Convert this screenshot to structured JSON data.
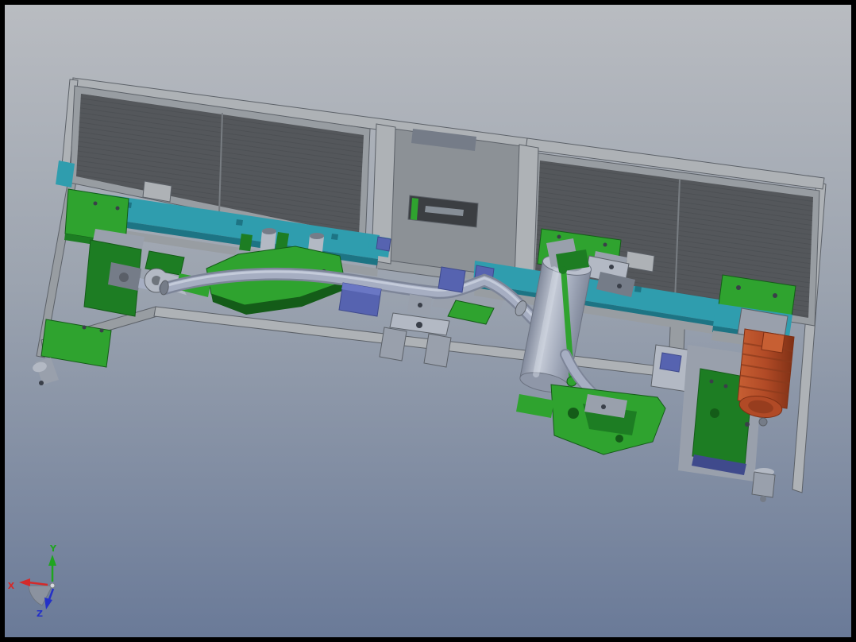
{
  "triad": {
    "x_label": "X",
    "y_label": "Y",
    "z_label": "Z"
  },
  "colors": {
    "bg_top": "#b9bcc1",
    "bg_mid": "#9ba3af",
    "bg_bottom": "#6a7a98",
    "frame_light": "#aeb2b6",
    "frame_mid": "#989da2",
    "edge": "#5c6168",
    "panel_dark": "#54575b",
    "panel_line": "#787d82",
    "gray_mid": "#8c9196",
    "gray_dark_panel": "#3b3e42",
    "teal": "#2f9dae",
    "teal_dark": "#1d7484",
    "green": "#2fa32f",
    "green_dark": "#1d7d23",
    "green_deep": "#145c18",
    "tube": "#a6aec2",
    "tube_light": "#ccd2e0",
    "tube_dark": "#7d8598",
    "cyl_light": "#c4cad6",
    "cyl_mid": "#9fa7b8",
    "cyl_dark": "#828a9c",
    "gray_part": "#99a0ac",
    "gray_part_light": "#b3b9c4",
    "gray_part_dark": "#757c88",
    "blue_part": "#5663b0",
    "blue_light": "#6a77c4",
    "blue_dark": "#3f4a8c",
    "orange": "#b14a26",
    "orange_dark": "#7e3015",
    "orange_light": "#c75f33",
    "bolt": "#3a3f49",
    "x_axis": "#d42a2a",
    "y_axis": "#1fa51f",
    "z_axis": "#2431c8",
    "triad_gray": "#9096a0"
  },
  "model": {
    "parts": [
      "main-frame",
      "left-guard-panel",
      "right-guard-panel",
      "center-bay",
      "control-panel",
      "left-conveyor-belt",
      "right-conveyor-belt",
      "left-end-bracket-set",
      "left-roller",
      "welding-jig-left",
      "bent-tube-workpiece",
      "center-support-fixture",
      "guide-block",
      "roller-cylinder",
      "lower-green-fixture",
      "right-bracket-set",
      "drive-motor",
      "drain-valve",
      "orientation-triad"
    ]
  }
}
